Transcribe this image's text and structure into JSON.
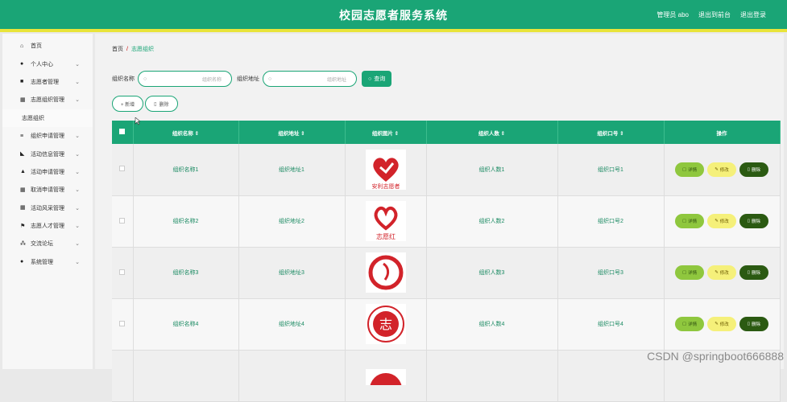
{
  "header": {
    "title": "校园志愿者服务系统",
    "user_label": "管理员 abo",
    "go_front": "退出到前台",
    "logout": "退出登录"
  },
  "sidebar": {
    "items": [
      {
        "label": "首页",
        "icon": "home-icon",
        "glyph": "⌂",
        "chev": ""
      },
      {
        "label": "个人中心",
        "icon": "user-icon",
        "glyph": "●",
        "chev": "⌄"
      },
      {
        "label": "志愿者管理",
        "icon": "volunteer-icon",
        "glyph": "■",
        "chev": "⌄"
      },
      {
        "label": "志愿组织管理",
        "icon": "grid-icon",
        "glyph": "▦",
        "chev": "⌄"
      },
      {
        "label": "志愿组织",
        "sub": true
      },
      {
        "label": "组织申请管理",
        "icon": "list-icon",
        "glyph": "≡",
        "chev": "⌄"
      },
      {
        "label": "活动信息管理",
        "icon": "flag-icon",
        "glyph": "◣",
        "chev": "⌄"
      },
      {
        "label": "活动申请管理",
        "icon": "thumb-icon",
        "glyph": "▲",
        "chev": "⌄"
      },
      {
        "label": "取消申请管理",
        "icon": "apps-icon",
        "glyph": "▦",
        "chev": "⌄"
      },
      {
        "label": "活动风采管理",
        "icon": "apps-icon",
        "glyph": "▦",
        "chev": "⌄"
      },
      {
        "label": "志愿人才管理",
        "icon": "flag-icon",
        "glyph": "⚑",
        "chev": "⌄"
      },
      {
        "label": "交流论坛",
        "icon": "forum-icon",
        "glyph": "⁂",
        "chev": "⌄"
      },
      {
        "label": "系统管理",
        "icon": "pin-icon",
        "glyph": "●",
        "chev": "⌄"
      }
    ]
  },
  "breadcrumb": {
    "home": "首页",
    "sep": "/",
    "current": "志愿组织"
  },
  "search": {
    "name_label": "组织名称",
    "name_placeholder": "组织名称",
    "addr_label": "组织地址",
    "addr_placeholder": "组织地址",
    "query": "查询"
  },
  "actions": {
    "add": "+ 新增",
    "delete": "删除"
  },
  "table": {
    "headers": [
      "组织名称 ⇕",
      "组织地址 ⇕",
      "组织图片 ⇕",
      "组织人数 ⇕",
      "组织口号 ⇕",
      "操作"
    ],
    "rows": [
      {
        "name": "组织名称1",
        "addr": "组织地址1",
        "count": "组织人数1",
        "slogan": "组织口号1",
        "logo_text": "安利志愿者"
      },
      {
        "name": "组织名称2",
        "addr": "组织地址2",
        "count": "组织人数2",
        "slogan": "组织口号2",
        "logo_text": "志愿红"
      },
      {
        "name": "组织名称3",
        "addr": "组织地址3",
        "count": "组织人数3",
        "slogan": "组织口号3",
        "logo_text": ""
      },
      {
        "name": "组织名称4",
        "addr": "组织地址4",
        "count": "组织人数4",
        "slogan": "组织口号4",
        "logo_text": "志"
      }
    ],
    "op_detail": "详情",
    "op_edit": "修改",
    "op_delete": "删除"
  },
  "watermark": "CSDN @springboot666888",
  "colors": {
    "primary": "#1aa576",
    "accent": "#e9e43a",
    "danger": "#d2232a"
  }
}
